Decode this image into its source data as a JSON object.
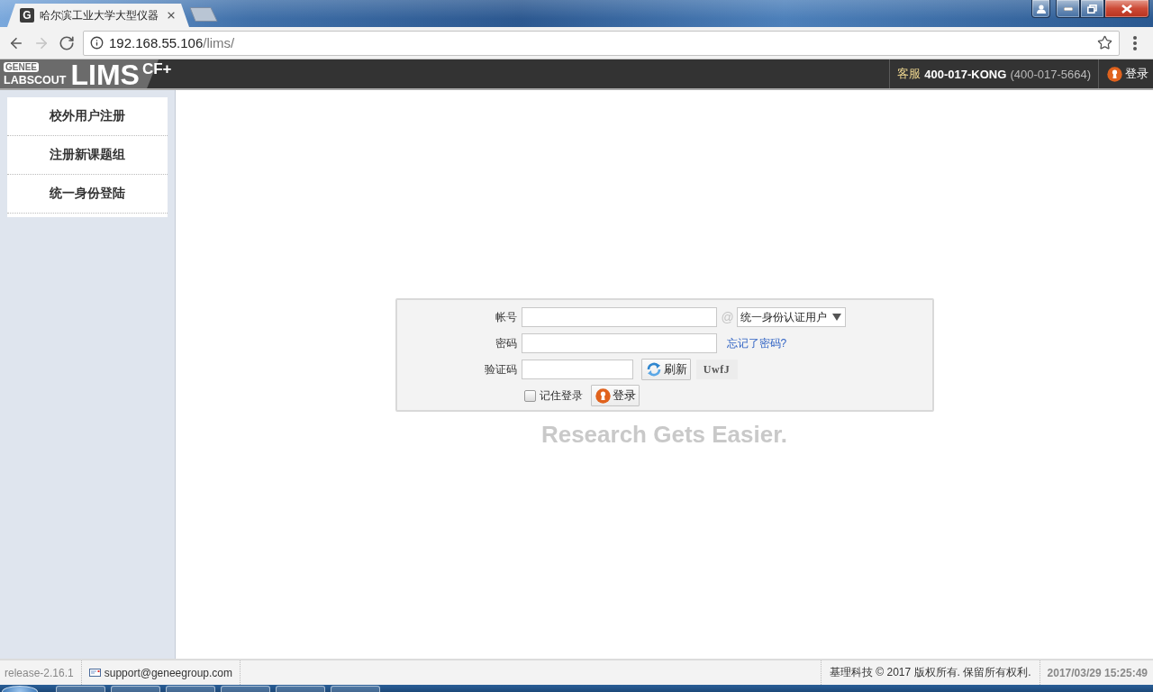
{
  "browser": {
    "tab": {
      "favicon": "G",
      "title": "哈尔滨工业大学大型仪器",
      "selected": true
    },
    "nav": [
      {
        "kind": "back",
        "disabled": false
      },
      {
        "kind": "forward",
        "disabled": true
      },
      {
        "kind": "reload",
        "disabled": false
      }
    ],
    "address": {
      "host": "192.168.55.106",
      "path": "/lims/"
    }
  },
  "header": {
    "logo": {
      "badge": "GENEE",
      "subtitle": "LABSCOUT",
      "name": "LIMS",
      "superscript": "CF+"
    },
    "support": {
      "label": "客服",
      "hotline": "400-017-KONG",
      "number": "(400-017-5664)"
    },
    "login": "登录"
  },
  "sidebar": {
    "items": [
      {
        "label": "校外用户注册"
      },
      {
        "label": "注册新课题组"
      },
      {
        "label": "统一身份登陆"
      }
    ]
  },
  "login_form": {
    "fields": [
      {
        "kind": "account",
        "label": "帐号"
      },
      {
        "kind": "password",
        "label": "密码"
      },
      {
        "kind": "captcha",
        "label": "验证码"
      }
    ],
    "at_sign": "@",
    "domain": "统一身份认证用户",
    "forgot_link": "忘记了密码?",
    "refresh_button": "刷新",
    "captcha_text": "UwfJ",
    "remember": {
      "label": "记住登录",
      "checked": false
    },
    "submit": "登录"
  },
  "tagline": "Research Gets Easier.",
  "footer": {
    "version": "release-2.16.1",
    "email": "support@geneegroup.com",
    "copyright": "基理科技 © 2017 版权所有. 保留所有权利.",
    "datetime": "2017/03/29 15:25:49"
  }
}
